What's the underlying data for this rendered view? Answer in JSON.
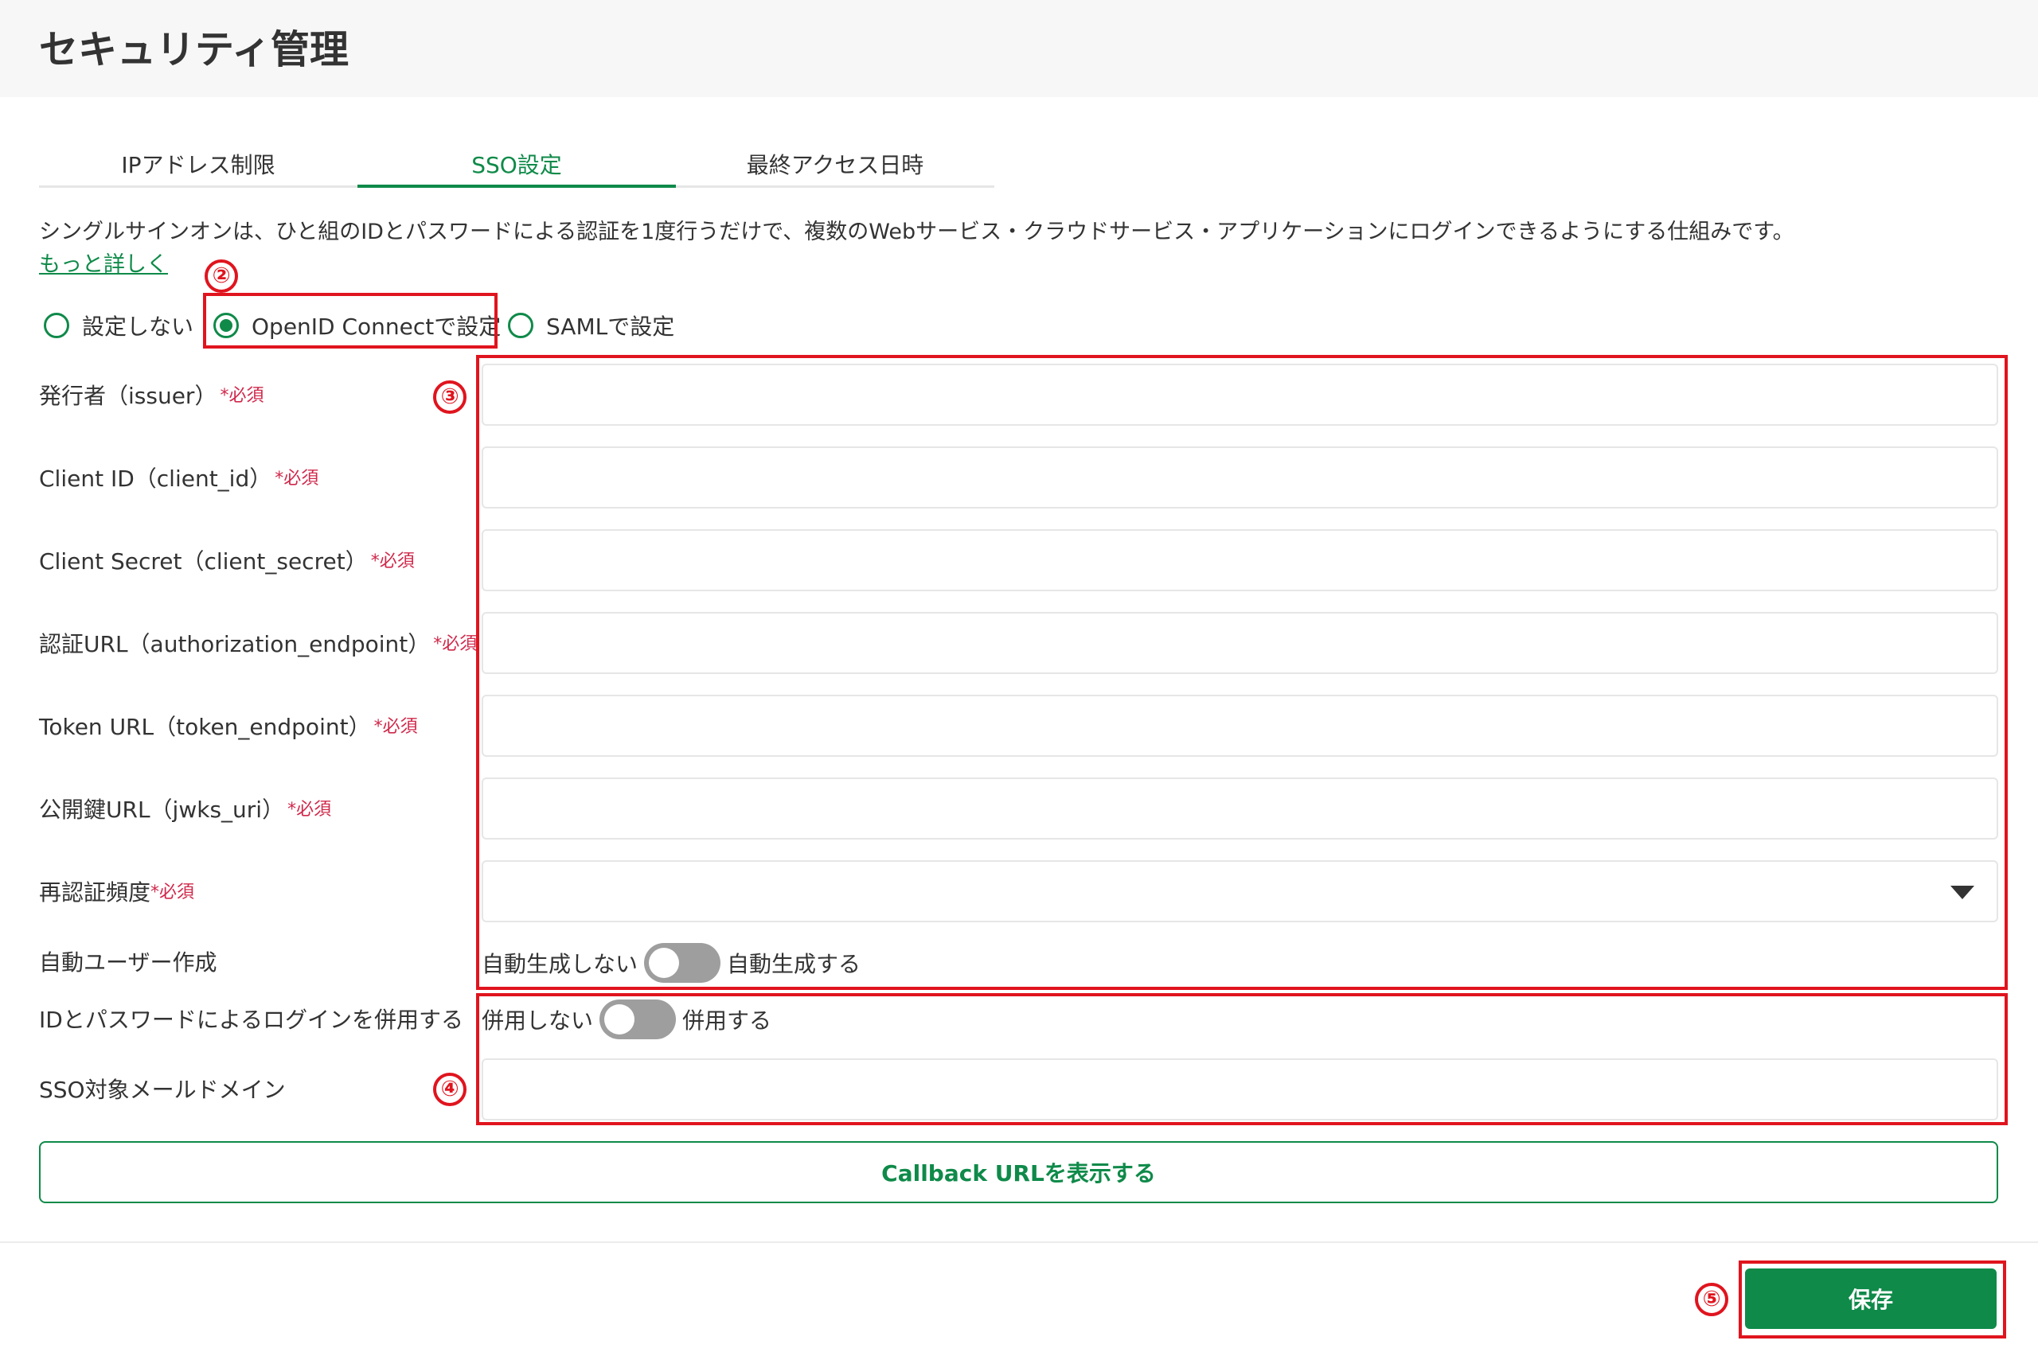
{
  "header": {
    "title": "セキュリティ管理"
  },
  "tabs": [
    {
      "label": "IPアドレス制限"
    },
    {
      "label": "SSO設定"
    },
    {
      "label": "最終アクセス日時"
    }
  ],
  "sso": {
    "description": "シングルサインオンは、ひと組のIDとパスワードによる認証を1度行うだけで、複数のWebサービス・クラウドサービス・アプリケーションにログインできるようにする仕組みです。",
    "learn_more": "もっと詳しく",
    "options": [
      {
        "label": "設定しない",
        "checked": false
      },
      {
        "label": "OpenID Connectで設定",
        "checked": true
      },
      {
        "label": "SAMLで設定",
        "checked": false
      }
    ],
    "required_mark": "*必須",
    "fields": {
      "issuer": {
        "label": "発行者（issuer）",
        "value": ""
      },
      "client_id": {
        "label": "Client ID（client_id）",
        "value": ""
      },
      "client_secret": {
        "label": "Client Secret（client_secret）",
        "value": ""
      },
      "authorization_endpoint": {
        "label": "認証URL（authorization_endpoint）",
        "value": ""
      },
      "token_endpoint": {
        "label": "Token URL（token_endpoint）",
        "value": ""
      },
      "jwks_uri": {
        "label": "公開鍵URL（jwks_uri）",
        "value": ""
      },
      "reauth_frequency": {
        "label": "再認証頻度",
        "value": ""
      },
      "sso_domain": {
        "label": "SSO対象メールドメイン",
        "value": ""
      }
    },
    "auto_user": {
      "label": "自動ユーザー作成",
      "off_label": "自動生成しない",
      "on_label": "自動生成する",
      "enabled": false
    },
    "combined_login": {
      "label": "IDとパスワードによるログインを併用する",
      "off_label": "併用しない",
      "on_label": "併用する",
      "enabled": false
    },
    "callback_button": "Callback URLを表示する",
    "save_button": "保存"
  },
  "annotations": [
    "②",
    "③",
    "④",
    "⑤"
  ],
  "colors": {
    "accent": "#0f8a49",
    "required": "#d0284b",
    "annotation": "#e0141e",
    "toggle_off": "#9e9e9e"
  }
}
